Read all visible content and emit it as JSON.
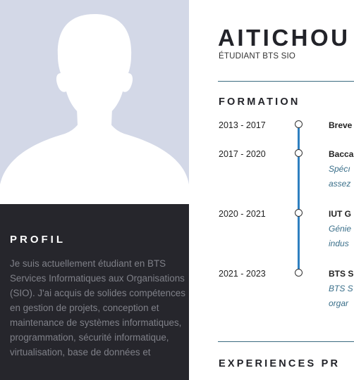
{
  "header": {
    "name": "AITICHOU",
    "role": "ÉTUDIANT BTS SIO"
  },
  "profile": {
    "title": "PROFIL",
    "text": "Je suis actuellement étudiant en BTS Services Informatiques aux Organisations (SIO). J'ai acquis de solides compétences en gestion de projets, conception et maintenance de systèmes informatiques, programmation, sécurité informatique, virtualisation, base de données et"
  },
  "formation": {
    "title": "FORMATION",
    "items": [
      {
        "date": "2013 - 2017",
        "title": "Breve",
        "desc": []
      },
      {
        "date": "2017 - 2020",
        "title": "Bacca",
        "desc": [
          "Spécı",
          "assez"
        ]
      },
      {
        "date": "2020 - 2021",
        "title": "IUT G",
        "desc": [
          "Génie",
          "indus"
        ]
      },
      {
        "date": "2021 - 2023",
        "title": "BTS S",
        "desc": [
          "BTS S",
          "orgar"
        ]
      }
    ]
  },
  "experience": {
    "title": "EXPERIENCES PR"
  },
  "colors": {
    "accent": "#2f7fc0",
    "sidebar_bg": "#26262c",
    "photo_bg": "#d3d8e7",
    "desc_text": "#3a6f8a"
  }
}
